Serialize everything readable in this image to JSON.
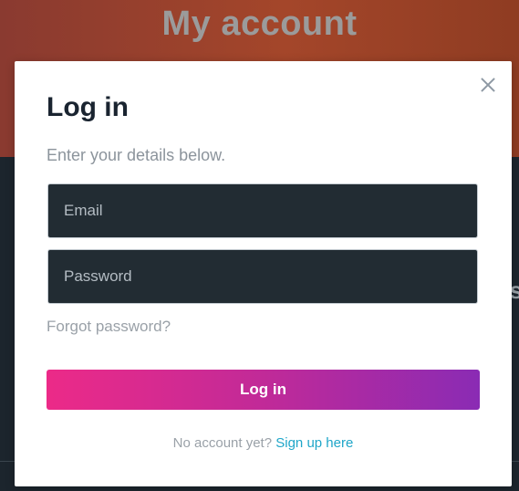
{
  "hero": {
    "title": "My account",
    "background_fragment": "s"
  },
  "modal": {
    "title": "Log in",
    "subtitle": "Enter your details below.",
    "close_icon": "close-icon",
    "email": {
      "placeholder": "Email",
      "value": ""
    },
    "password": {
      "placeholder": "Password",
      "value": ""
    },
    "forgot_label": "Forgot password?",
    "login_label": "Log in",
    "signup_prefix": "No account yet?",
    "signup_link": "Sign up here"
  },
  "colors": {
    "accent_start": "#ec2a88",
    "accent_end": "#8a2bb4",
    "link": "#1fa6c9",
    "hero_bg": "#a4462a",
    "page_bg": "#1c252d"
  }
}
